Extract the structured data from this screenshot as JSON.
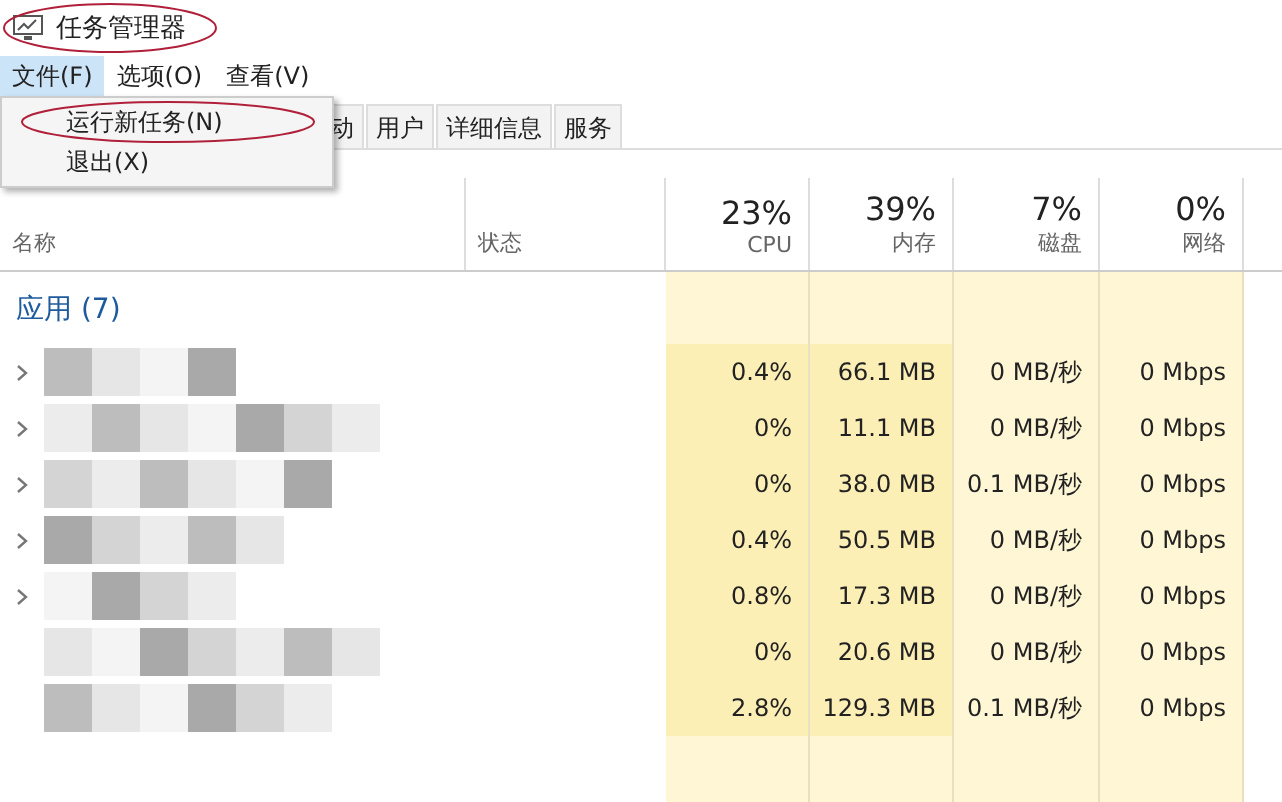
{
  "window": {
    "title": "任务管理器",
    "title_highlighted": true
  },
  "menu_bar": [
    {
      "label": "文件(F)",
      "selected": true
    },
    {
      "label": "选项(O)",
      "selected": false
    },
    {
      "label": "查看(V)",
      "selected": false
    }
  ],
  "file_menu": [
    {
      "label": "运行新任务(N)",
      "highlighted": true
    },
    {
      "label": "退出(X)",
      "highlighted": false
    }
  ],
  "tabs": [
    {
      "label": "动",
      "selected": false
    },
    {
      "label": "用户",
      "selected": false
    },
    {
      "label": "详细信息",
      "selected": false
    },
    {
      "label": "服务",
      "selected": false
    }
  ],
  "columns": [
    {
      "label": "名称"
    },
    {
      "label": "状态"
    },
    {
      "percent": "23%",
      "label": "CPU"
    },
    {
      "percent": "39%",
      "label": "内存"
    },
    {
      "percent": "7%",
      "label": "磁盘"
    },
    {
      "percent": "0%",
      "label": "网络"
    }
  ],
  "section": "应用 (7)",
  "rows": [
    {
      "expandable": true,
      "cpu": "0.4%",
      "memory": "66.1 MB",
      "disk": "0 MB/秒",
      "network": "0 Mbps"
    },
    {
      "expandable": true,
      "cpu": "0%",
      "memory": "11.1 MB",
      "disk": "0 MB/秒",
      "network": "0 Mbps"
    },
    {
      "expandable": true,
      "cpu": "0%",
      "memory": "38.0 MB",
      "disk": "0.1 MB/秒",
      "network": "0 Mbps"
    },
    {
      "expandable": true,
      "cpu": "0.4%",
      "memory": "50.5 MB",
      "disk": "0 MB/秒",
      "network": "0 Mbps"
    },
    {
      "expandable": true,
      "cpu": "0.8%",
      "memory": "17.3 MB",
      "disk": "0 MB/秒",
      "network": "0 Mbps"
    },
    {
      "expandable": false,
      "cpu": "0%",
      "memory": "20.6 MB",
      "disk": "0 MB/秒",
      "network": "0 Mbps"
    },
    {
      "expandable": false,
      "cpu": "2.8%",
      "memory": "129.3 MB",
      "disk": "0.1 MB/秒",
      "network": "0 Mbps"
    }
  ]
}
